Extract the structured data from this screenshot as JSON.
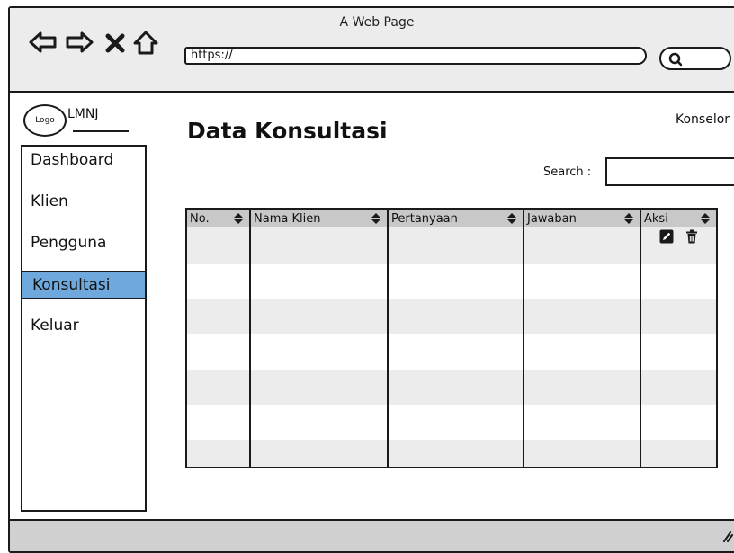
{
  "window": {
    "title": "A Web Page"
  },
  "browser": {
    "url": "https://",
    "icons": [
      "back-arrow-icon",
      "forward-arrow-icon",
      "stop-icon",
      "home-icon",
      "search-icon"
    ]
  },
  "brand": {
    "logo_text": "Logo",
    "name": "LMNJ"
  },
  "user": {
    "role_label": "Konselor"
  },
  "sidebar": {
    "items": [
      {
        "label": "Dashboard",
        "active": false
      },
      {
        "label": "Klien",
        "active": false
      },
      {
        "label": "Pengguna",
        "active": false
      },
      {
        "label": "Konsultasi",
        "active": true
      },
      {
        "label": "Keluar",
        "active": false
      }
    ],
    "active_color": "#6fa8dc"
  },
  "page": {
    "title": "Data Konsultasi"
  },
  "search": {
    "label": "Search :",
    "value": ""
  },
  "table": {
    "columns": [
      "No.",
      "Nama Klien",
      "Pertanyaan",
      "Jawaban",
      "Aksi"
    ],
    "action_icons": [
      "edit-icon",
      "delete-icon"
    ],
    "header_color": "#c8c8c8",
    "stripe_color": "#ececec"
  }
}
